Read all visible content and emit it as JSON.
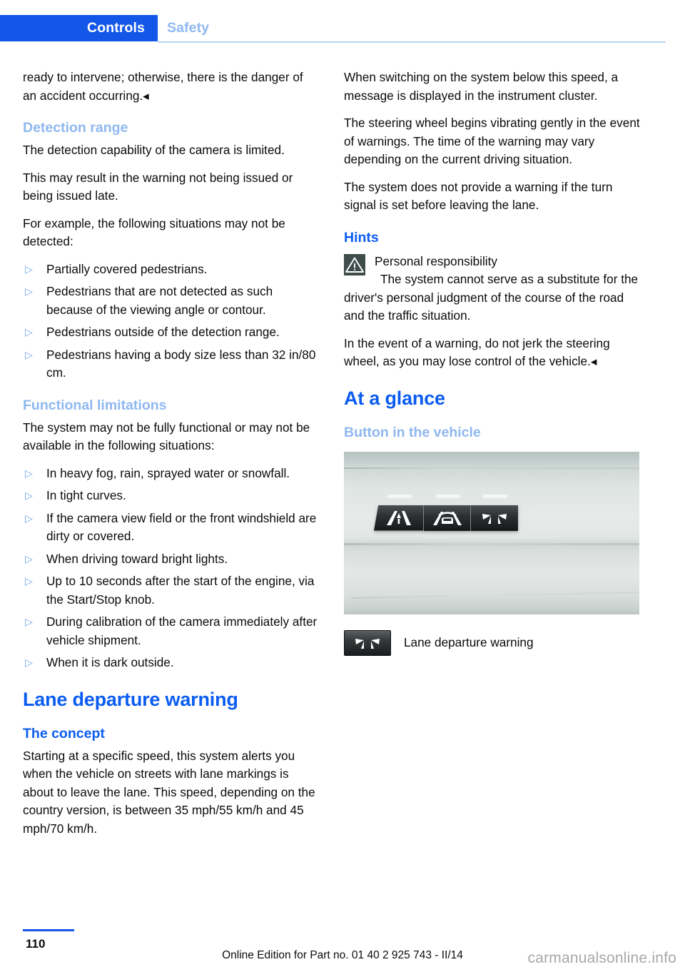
{
  "header": {
    "active_tab": "Controls",
    "inactive_tab": "Safety"
  },
  "left_column": {
    "continued_paragraph": "ready to intervene; otherwise, there is the danger of an accident occurring.◂",
    "detection_range": {
      "heading": "Detection range",
      "p1": "The detection capability of the camera is limited.",
      "p2": "This may result in the warning not being issued or being issued late.",
      "p3": "For example, the following situations may not be detected:",
      "bullets": [
        "Partially covered pedestrians.",
        "Pedestrians that are not detected as such because of the viewing angle or contour.",
        "Pedestrians outside of the detection range.",
        "Pedestrians having a body size less than 32 in/80 cm."
      ]
    },
    "functional_limitations": {
      "heading": "Functional limitations",
      "p1": "The system may not be fully functional or may not be available in the following situations:",
      "bullets": [
        "In heavy fog, rain, sprayed water or snowfall.",
        "In tight curves.",
        "If the camera view field or the front windshield are dirty or covered.",
        "When driving toward bright lights.",
        "Up to 10 seconds after the start of the engine, via the Start/Stop knob.",
        "During calibration of the camera immediately after vehicle shipment.",
        "When it is dark outside."
      ]
    },
    "lane_departure_warning": {
      "heading": "Lane departure warning",
      "concept_heading": "The concept",
      "concept_p1": "Starting at a specific speed, this system alerts you when the vehicle on streets with lane markings is about to leave the lane. This speed, depending on the country version, is between 35 mph/55 km/h and 45 mph/70 km/h."
    }
  },
  "right_column": {
    "p1": "When switching on the system below this speed, a message is displayed in the instrument cluster.",
    "p2": "The steering wheel begins vibrating gently in the event of warnings. The time of the warning may vary depending on the current driving situation.",
    "p3": "The system does not provide a warning if the turn signal is set before leaving the lane.",
    "hints": {
      "heading": "Hints",
      "warning_title": "Personal responsibility",
      "warning_body": "The system cannot serve as a substitute for the driver's personal judgment of the course of the road and the traffic situation.",
      "p_after": "In the event of a warning, do not jerk the steering wheel, as you may lose control of the vehicle.◂"
    },
    "at_a_glance": {
      "heading": "At a glance",
      "subheading": "Button in the vehicle",
      "legend_label": "Lane departure warning"
    }
  },
  "footer": {
    "page_number": "110",
    "edition_text": "Online Edition for Part no. 01 40 2 925 743 - II/14",
    "watermark": "carmanualsonline.info"
  },
  "colors": {
    "accent_blue": "#1257e8",
    "heading_blue": "#0b5cf0",
    "light_blue": "#8fb8f0",
    "bullet_blue": "#6fa4ea",
    "warning_icon_bg": "#3e4c4a",
    "text": "#0b0b0b"
  }
}
